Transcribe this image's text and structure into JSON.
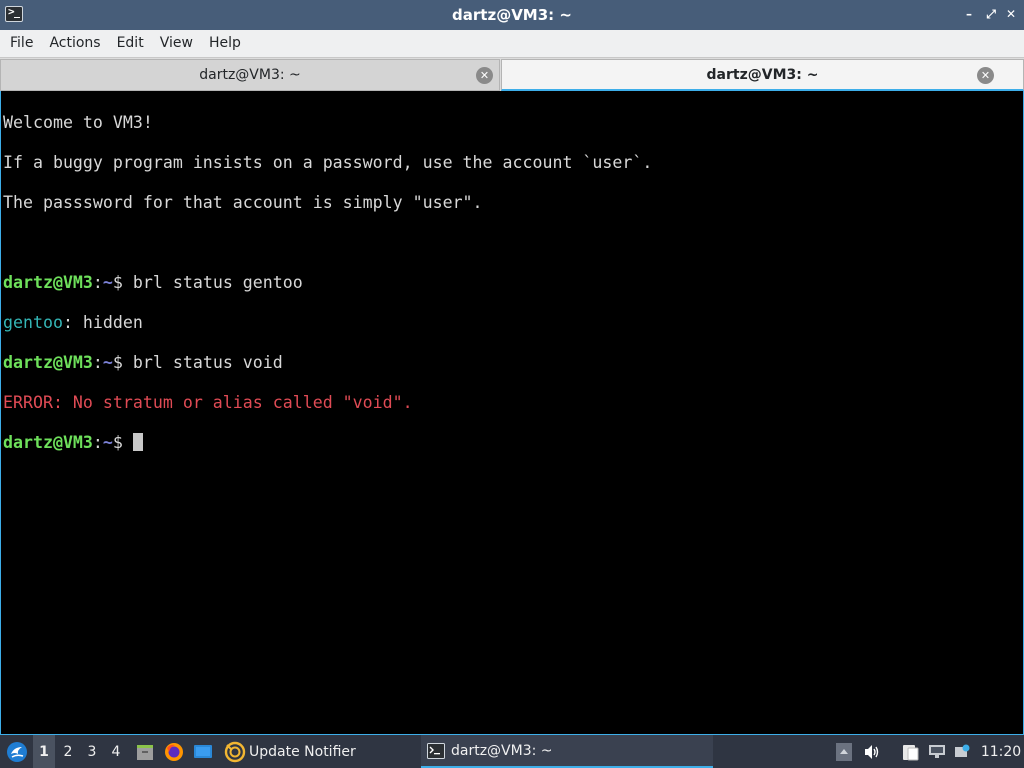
{
  "window": {
    "title": "dartz@VM3: ~",
    "minimize_icon": "–",
    "maximize_icon": "⤢",
    "close_icon": "✕"
  },
  "menu": [
    "File",
    "Actions",
    "Edit",
    "View",
    "Help"
  ],
  "tabs": [
    {
      "label": "dartz@VM3: ~",
      "active": false
    },
    {
      "label": "dartz@VM3: ~",
      "active": true
    }
  ],
  "terminal": {
    "welcome": [
      "Welcome to VM3!",
      "If a buggy program insists on a password, use the account `user`.",
      "The passsword for that account is simply \"user\"."
    ],
    "prompt_user": "dartz@VM3",
    "prompt_sep": ":",
    "prompt_path": "~",
    "prompt_char": "$ ",
    "cmd1": "brl status gentoo",
    "out1_name": "gentoo",
    "out1_rest": ": hidden",
    "cmd2": "brl status void",
    "out2": "ERROR: No stratum or alias called \"void\"."
  },
  "taskbar": {
    "desktops": [
      "1",
      "2",
      "3",
      "4"
    ],
    "current_desktop": "1",
    "update_notifier": "Update Notifier",
    "task_title": "dartz@VM3: ~",
    "clock": "11:20"
  },
  "colors": {
    "titlebar": "#475d79",
    "accent": "#3daee9",
    "prompt_user": "#6ee05b",
    "prompt_path": "#7c82d8",
    "error": "#e04b55",
    "cyan": "#34b6b6",
    "taskbar": "#2f3542"
  }
}
